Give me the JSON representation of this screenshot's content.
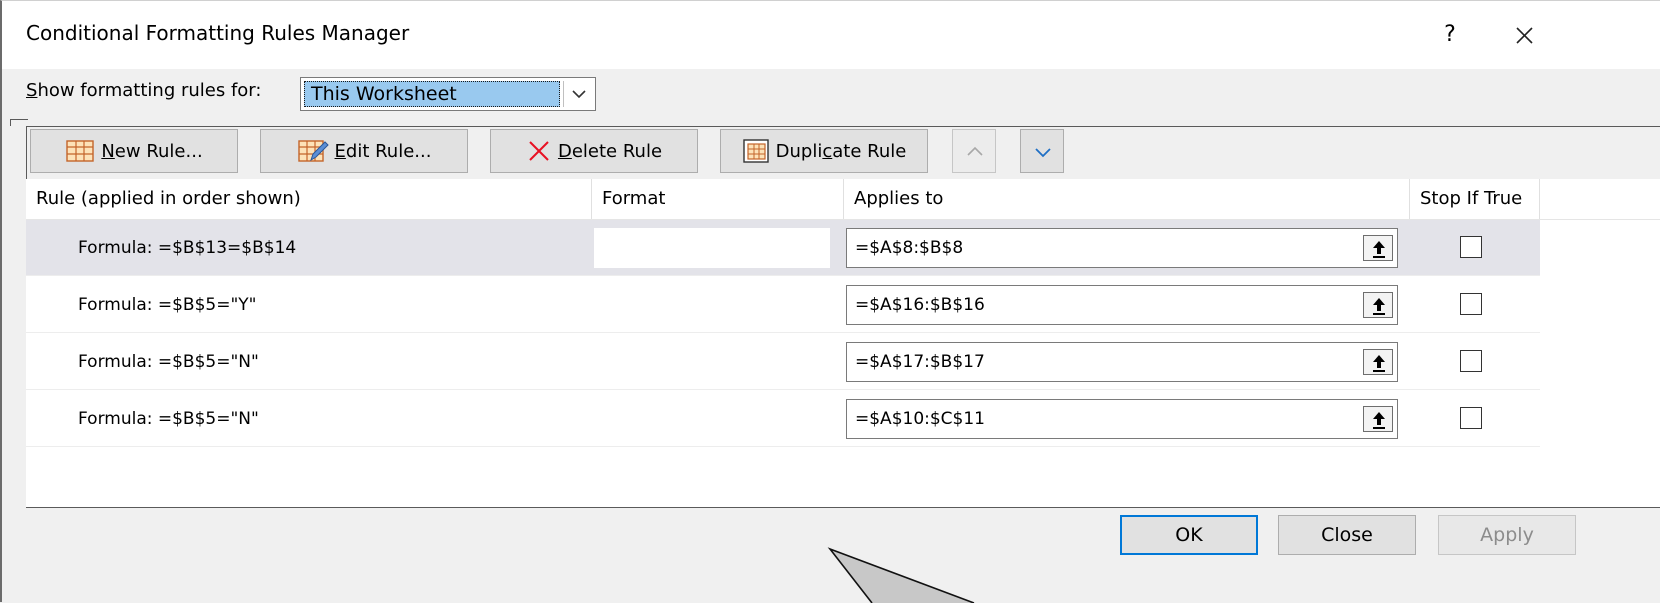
{
  "window": {
    "title": "Conditional Formatting Rules Manager",
    "help_label": "?"
  },
  "scope": {
    "label_prefix": "S",
    "label_rest": "how formatting rules for:",
    "selected": "This Worksheet"
  },
  "toolbar": {
    "new_rule": {
      "mnemonic": "N",
      "rest": "ew Rule..."
    },
    "edit_rule": {
      "mnemonic": "E",
      "rest": "dit Rule..."
    },
    "delete_rule": {
      "mnemonic": "D",
      "rest": "elete Rule"
    },
    "duplicate_rule": {
      "before": "Dupli",
      "mnemonic": "c",
      "rest": "ate Rule"
    }
  },
  "table": {
    "headers": [
      "Rule (applied in order shown)",
      "Format",
      "Applies to",
      "Stop If True"
    ],
    "rows": [
      {
        "rule": "Formula: =$B$13=$B$14",
        "applies_to": "=$A$8:$B$8",
        "selected": true
      },
      {
        "rule": "Formula: =$B$5=\"Y\"",
        "applies_to": "=$A$16:$B$16",
        "selected": false
      },
      {
        "rule": "Formula: =$B$5=\"N\"",
        "applies_to": "=$A$17:$B$17",
        "selected": false
      },
      {
        "rule": "Formula: =$B$5=\"N\"",
        "applies_to": "=$A$10:$C$11",
        "selected": false
      }
    ]
  },
  "buttons": {
    "ok": "OK",
    "close": "Close",
    "apply": "Apply"
  },
  "colors": {
    "selection": "#99c9ef",
    "selected_row": "#e3e3e9",
    "default_button_border": "#0078d7",
    "delete_icon": "#e81123"
  }
}
